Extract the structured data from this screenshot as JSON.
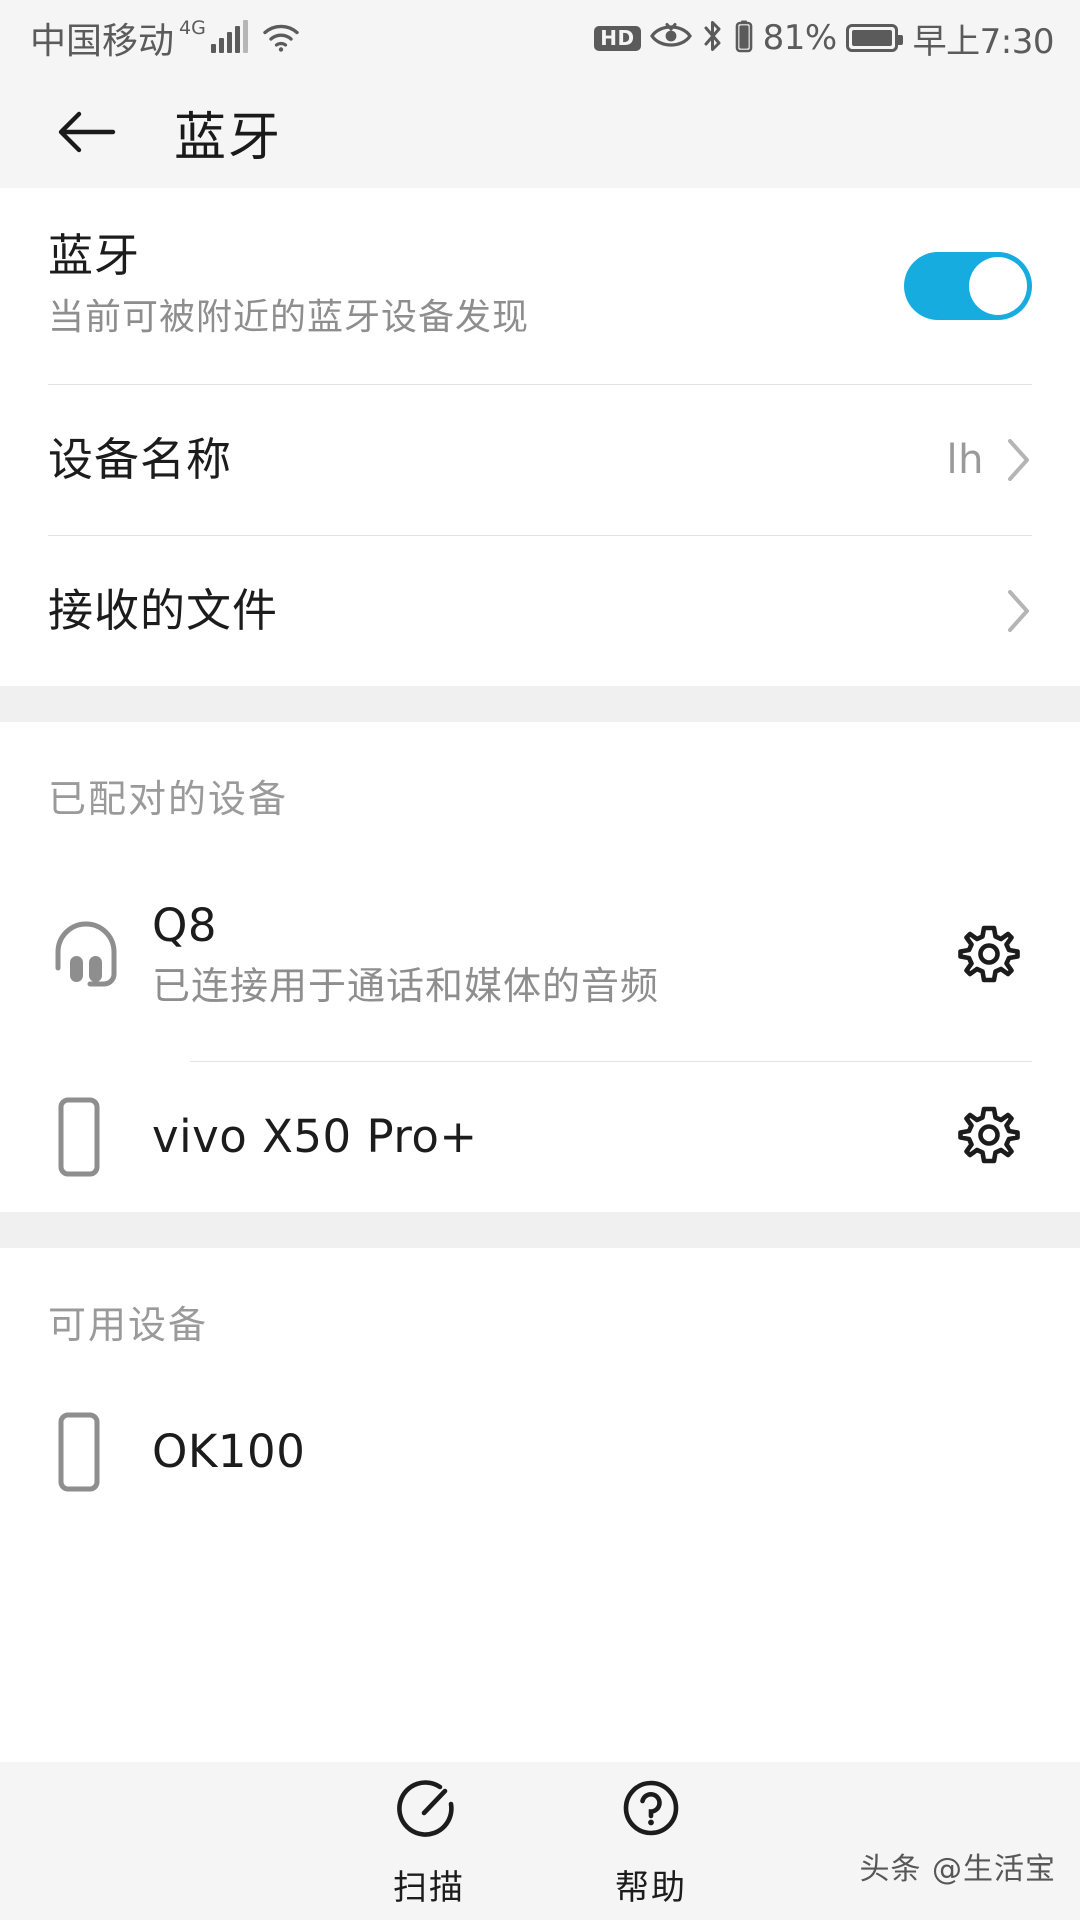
{
  "status_bar": {
    "carrier": "中国移动",
    "network_type": "4G",
    "icons": [
      "signal-bars-icon",
      "wifi-icon",
      "hd-icon",
      "eye-comfort-icon",
      "bluetooth-icon",
      "small-battery-icon",
      "battery-icon"
    ],
    "hd_label": "HD",
    "battery_percent": "81%",
    "time": "早上7:30"
  },
  "app_bar": {
    "back_label": "back-arrow",
    "title": "蓝牙"
  },
  "bluetooth_toggle_row": {
    "title": "蓝牙",
    "subtitle": "当前可被附近的蓝牙设备发现",
    "enabled": true,
    "accent_color": "#16ace0"
  },
  "settings_rows": [
    {
      "title": "设备名称",
      "value": "lh",
      "has_chevron": true
    },
    {
      "title": "接收的文件",
      "value": "",
      "has_chevron": true
    }
  ],
  "paired_section": {
    "header": "已配对的设备",
    "devices": [
      {
        "name": "Q8",
        "status": "已连接用于通话和媒体的音频",
        "icon": "headphones-icon",
        "has_gear": true
      },
      {
        "name": "vivo X50 Pro+",
        "status": "",
        "icon": "phone-icon",
        "has_gear": true
      }
    ]
  },
  "available_section": {
    "header": "可用设备",
    "devices": [
      {
        "name": "OK100",
        "status": "",
        "icon": "phone-icon",
        "has_gear": false
      }
    ]
  },
  "bottom_bar": {
    "actions": [
      {
        "label": "扫描",
        "icon": "refresh-scan-icon"
      },
      {
        "label": "帮助",
        "icon": "question-circle-icon"
      }
    ]
  },
  "watermark": "头条 @生活宝"
}
